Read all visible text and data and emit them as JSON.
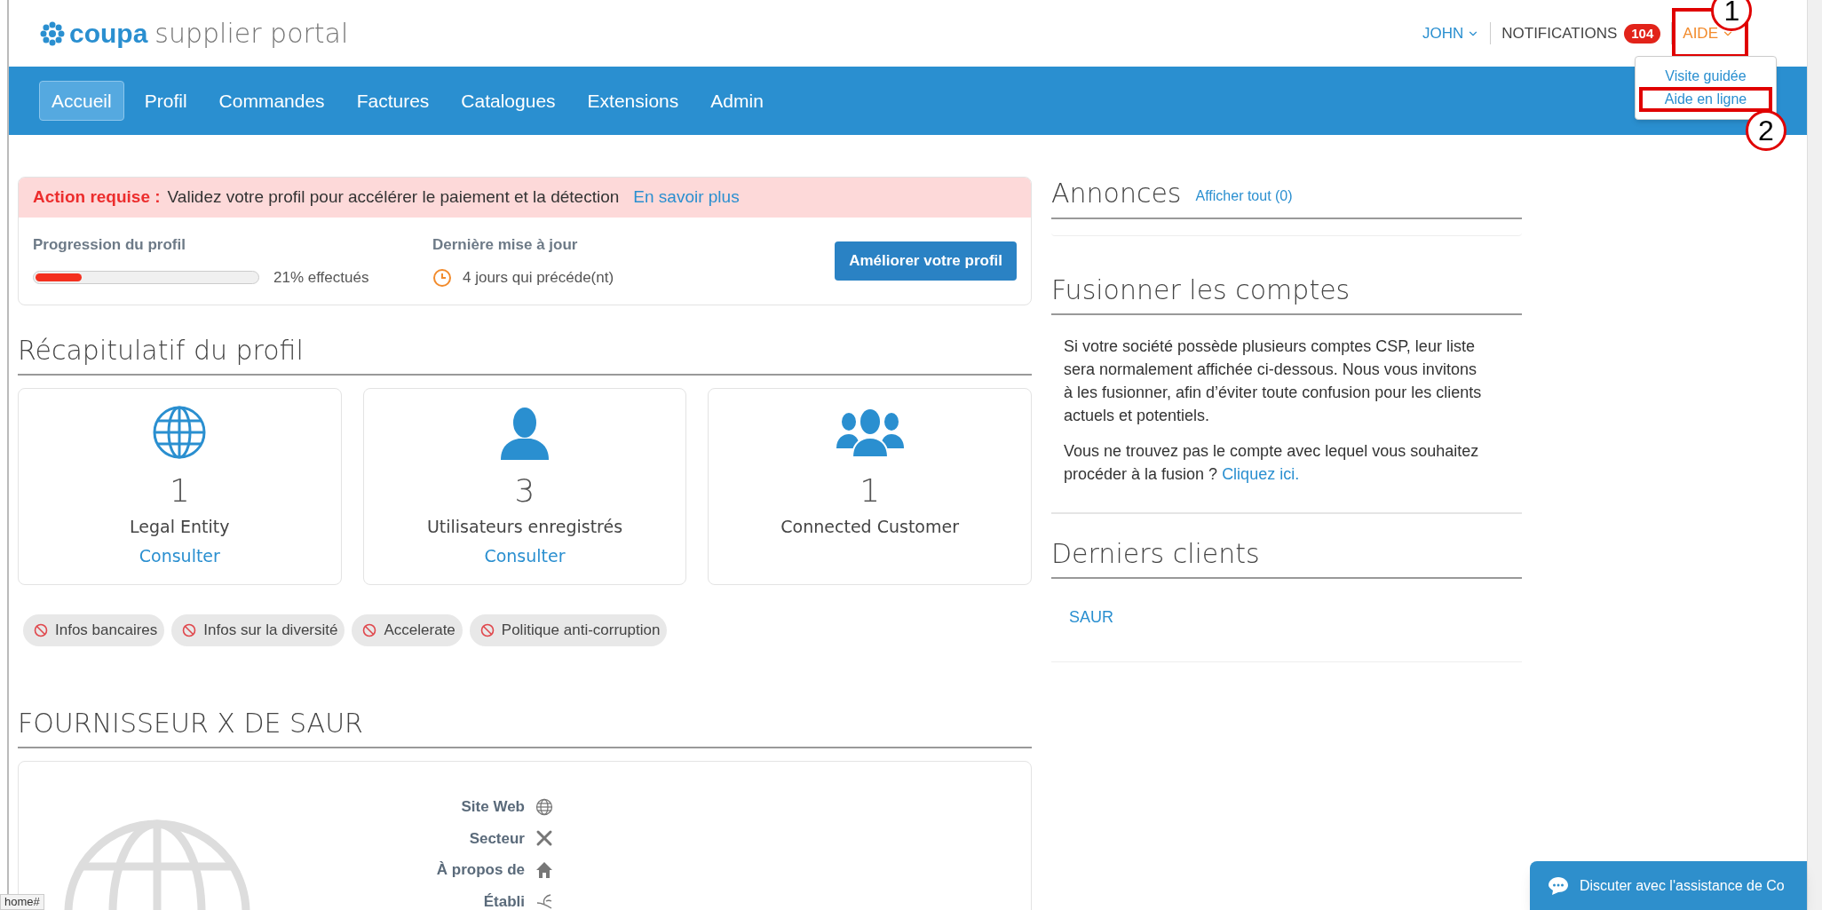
{
  "header": {
    "logo_brand": "coupa",
    "logo_product": "supplier portal",
    "user": "JOHN",
    "notifications": {
      "label": "NOTIFICATIONS",
      "count": "104"
    },
    "help": {
      "label": "AIDE",
      "expanded": true
    }
  },
  "help_menu": [
    {
      "label": "Visite guidée",
      "highlighted": false
    },
    {
      "label": "Aide en ligne",
      "highlighted": true
    }
  ],
  "annotations": [
    {
      "number": "1"
    },
    {
      "number": "2"
    }
  ],
  "nav_tabs": [
    {
      "label": "Accueil",
      "selected": true
    },
    {
      "label": "Profil",
      "selected": false
    },
    {
      "label": "Commandes",
      "selected": false
    },
    {
      "label": "Factures",
      "selected": false
    },
    {
      "label": "Catalogues",
      "selected": false
    },
    {
      "label": "Extensions",
      "selected": false
    },
    {
      "label": "Admin",
      "selected": false
    }
  ],
  "action_banner": {
    "label": "Action requise :",
    "message": "Validez votre profil pour accélérer le paiement et la détection",
    "link": "En savoir plus"
  },
  "profile_progress": {
    "title": "Progression du profil",
    "level": 0.21,
    "reading": "21% effectués",
    "update_title": "Dernière mise à jour",
    "update_value": "4 jours qui précéde(nt)",
    "button": "Améliorer votre profil"
  },
  "profile_summary": {
    "title": "Récapitulatif du profil",
    "cards": [
      {
        "kind": "globe",
        "count": "1",
        "label": "Legal Entity",
        "link": "Consulter"
      },
      {
        "kind": "user",
        "count": "3",
        "label": "Utilisateurs enregistrés",
        "link": "Consulter"
      },
      {
        "kind": "group",
        "count": "1",
        "label": "Connected Customer"
      }
    ],
    "chips": [
      "Infos bancaires",
      "Infos sur la diversité",
      "Accelerate",
      "Politique anti-corruption"
    ]
  },
  "supplier": {
    "title": "FOURNISSEUR X DE SAUR",
    "fields": [
      {
        "kind": "web",
        "label": "Site Web"
      },
      {
        "kind": "tools",
        "label": "Secteur"
      },
      {
        "kind": "home",
        "label": "À propos de"
      },
      {
        "kind": "plant",
        "label": "Établi"
      }
    ]
  },
  "announcements": {
    "title": "Annonces",
    "link": "Afficher tout (0)"
  },
  "merge_accounts": {
    "title": "Fusionner les comptes",
    "paragraph": "Si votre société possède plusieurs comptes CSP, leur liste sera normalement affichée ci-dessous. Nous vous invitons à les fusionner, afin d’éviter toute confusion pour les clients actuels et potentiels.",
    "question": "Vous ne trouvez pas le compte avec lequel vous souhaitez procéder à la fusion ?",
    "link": "Cliquez ici."
  },
  "recent_customers": {
    "title": "Derniers clients",
    "items": [
      "SAUR"
    ]
  },
  "chat_button": "Discuter avec l'assistance de Co",
  "status_bar": "home#"
}
